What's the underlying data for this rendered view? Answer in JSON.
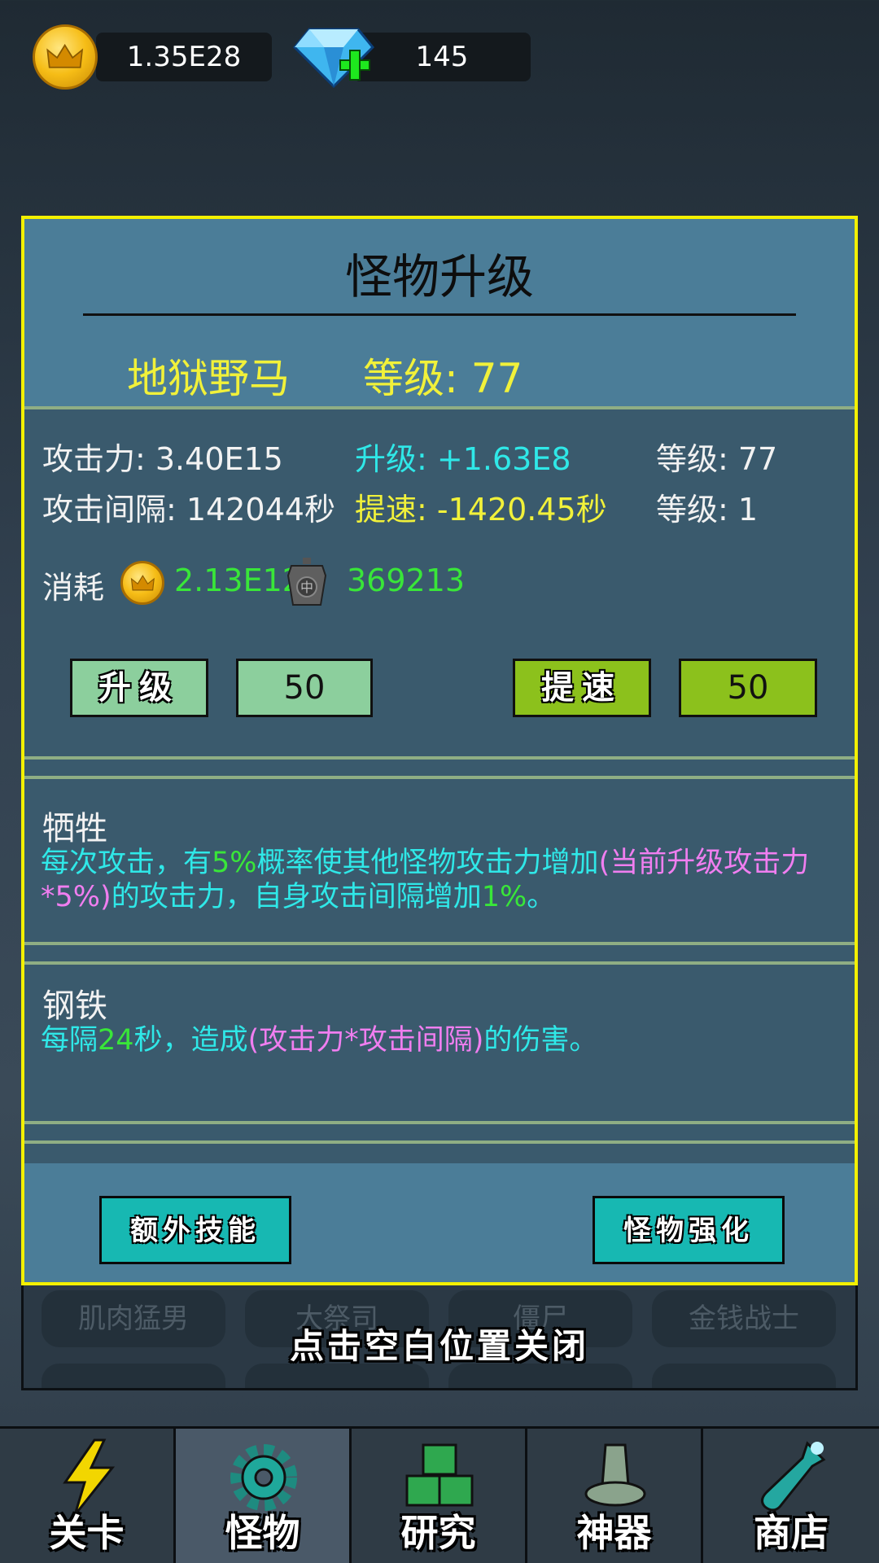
{
  "currency": {
    "gold": "1.35E28",
    "gems": "145"
  },
  "modal": {
    "title": "怪物升级",
    "monster_name": "地狱野马",
    "level_label": "等级: 77",
    "stats": {
      "attack": "攻击力: 3.40E15",
      "upgrade": "升级: +1.63E8",
      "attack_level": "等级: 77",
      "interval": "攻击间隔: 142044秒",
      "speedup": "提速: -1420.45秒",
      "interval_level": "等级: 1"
    },
    "cost": {
      "label": "消耗",
      "gold": "2.13E12",
      "token": "369213"
    },
    "buttons": {
      "upgrade": "升级",
      "upgrade_count": "50",
      "speedup": "提速",
      "speedup_count": "50",
      "extra_skill": "额外技能",
      "monster_enhance": "怪物强化"
    },
    "skills": [
      {
        "name": "牺牲",
        "desc_parts": [
          "每次攻击，有",
          "5%",
          "概率使其他怪物攻击力增加",
          "(当前升级攻击力*5%)",
          "的攻击力，自身攻击间隔增加",
          "1%",
          "。"
        ]
      },
      {
        "name": "钢铁",
        "desc_parts": [
          "每隔",
          "24",
          "秒，造成",
          "(攻击力*攻击间隔)",
          "的伤害。"
        ]
      }
    ]
  },
  "background": {
    "chips": [
      "肌肉猛男",
      "大祭司",
      "僵尸",
      "金钱战士"
    ],
    "close_hint": "点击空白位置关闭"
  },
  "nav": {
    "items": [
      "关卡",
      "怪物",
      "研究",
      "神器",
      "商店"
    ],
    "active": "怪物"
  },
  "colors": {
    "modal_border": "#f3f000",
    "accent_yellow": "#f1f13a",
    "accent_cyan": "#2fe8e8",
    "accent_green": "#39e639",
    "accent_pink": "#f07ef0"
  }
}
